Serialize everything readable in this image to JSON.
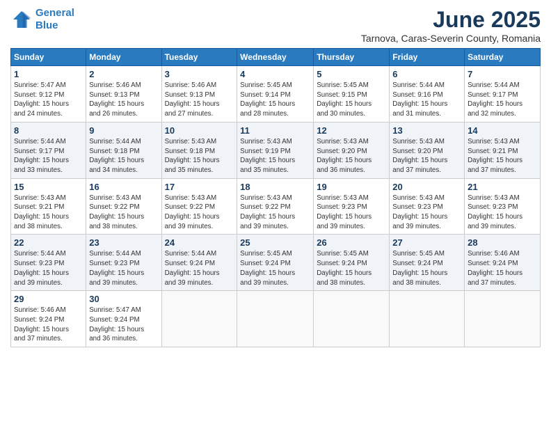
{
  "logo": {
    "line1": "General",
    "line2": "Blue"
  },
  "title": "June 2025",
  "location": "Tarnova, Caras-Severin County, Romania",
  "weekdays": [
    "Sunday",
    "Monday",
    "Tuesday",
    "Wednesday",
    "Thursday",
    "Friday",
    "Saturday"
  ],
  "weeks": [
    [
      {
        "day": "1",
        "info": "Sunrise: 5:47 AM\nSunset: 9:12 PM\nDaylight: 15 hours\nand 24 minutes."
      },
      {
        "day": "2",
        "info": "Sunrise: 5:46 AM\nSunset: 9:13 PM\nDaylight: 15 hours\nand 26 minutes."
      },
      {
        "day": "3",
        "info": "Sunrise: 5:46 AM\nSunset: 9:13 PM\nDaylight: 15 hours\nand 27 minutes."
      },
      {
        "day": "4",
        "info": "Sunrise: 5:45 AM\nSunset: 9:14 PM\nDaylight: 15 hours\nand 28 minutes."
      },
      {
        "day": "5",
        "info": "Sunrise: 5:45 AM\nSunset: 9:15 PM\nDaylight: 15 hours\nand 30 minutes."
      },
      {
        "day": "6",
        "info": "Sunrise: 5:44 AM\nSunset: 9:16 PM\nDaylight: 15 hours\nand 31 minutes."
      },
      {
        "day": "7",
        "info": "Sunrise: 5:44 AM\nSunset: 9:17 PM\nDaylight: 15 hours\nand 32 minutes."
      }
    ],
    [
      {
        "day": "8",
        "info": "Sunrise: 5:44 AM\nSunset: 9:17 PM\nDaylight: 15 hours\nand 33 minutes."
      },
      {
        "day": "9",
        "info": "Sunrise: 5:44 AM\nSunset: 9:18 PM\nDaylight: 15 hours\nand 34 minutes."
      },
      {
        "day": "10",
        "info": "Sunrise: 5:43 AM\nSunset: 9:18 PM\nDaylight: 15 hours\nand 35 minutes."
      },
      {
        "day": "11",
        "info": "Sunrise: 5:43 AM\nSunset: 9:19 PM\nDaylight: 15 hours\nand 35 minutes."
      },
      {
        "day": "12",
        "info": "Sunrise: 5:43 AM\nSunset: 9:20 PM\nDaylight: 15 hours\nand 36 minutes."
      },
      {
        "day": "13",
        "info": "Sunrise: 5:43 AM\nSunset: 9:20 PM\nDaylight: 15 hours\nand 37 minutes."
      },
      {
        "day": "14",
        "info": "Sunrise: 5:43 AM\nSunset: 9:21 PM\nDaylight: 15 hours\nand 37 minutes."
      }
    ],
    [
      {
        "day": "15",
        "info": "Sunrise: 5:43 AM\nSunset: 9:21 PM\nDaylight: 15 hours\nand 38 minutes."
      },
      {
        "day": "16",
        "info": "Sunrise: 5:43 AM\nSunset: 9:22 PM\nDaylight: 15 hours\nand 38 minutes."
      },
      {
        "day": "17",
        "info": "Sunrise: 5:43 AM\nSunset: 9:22 PM\nDaylight: 15 hours\nand 39 minutes."
      },
      {
        "day": "18",
        "info": "Sunrise: 5:43 AM\nSunset: 9:22 PM\nDaylight: 15 hours\nand 39 minutes."
      },
      {
        "day": "19",
        "info": "Sunrise: 5:43 AM\nSunset: 9:23 PM\nDaylight: 15 hours\nand 39 minutes."
      },
      {
        "day": "20",
        "info": "Sunrise: 5:43 AM\nSunset: 9:23 PM\nDaylight: 15 hours\nand 39 minutes."
      },
      {
        "day": "21",
        "info": "Sunrise: 5:43 AM\nSunset: 9:23 PM\nDaylight: 15 hours\nand 39 minutes."
      }
    ],
    [
      {
        "day": "22",
        "info": "Sunrise: 5:44 AM\nSunset: 9:23 PM\nDaylight: 15 hours\nand 39 minutes."
      },
      {
        "day": "23",
        "info": "Sunrise: 5:44 AM\nSunset: 9:23 PM\nDaylight: 15 hours\nand 39 minutes."
      },
      {
        "day": "24",
        "info": "Sunrise: 5:44 AM\nSunset: 9:24 PM\nDaylight: 15 hours\nand 39 minutes."
      },
      {
        "day": "25",
        "info": "Sunrise: 5:45 AM\nSunset: 9:24 PM\nDaylight: 15 hours\nand 39 minutes."
      },
      {
        "day": "26",
        "info": "Sunrise: 5:45 AM\nSunset: 9:24 PM\nDaylight: 15 hours\nand 38 minutes."
      },
      {
        "day": "27",
        "info": "Sunrise: 5:45 AM\nSunset: 9:24 PM\nDaylight: 15 hours\nand 38 minutes."
      },
      {
        "day": "28",
        "info": "Sunrise: 5:46 AM\nSunset: 9:24 PM\nDaylight: 15 hours\nand 37 minutes."
      }
    ],
    [
      {
        "day": "29",
        "info": "Sunrise: 5:46 AM\nSunset: 9:24 PM\nDaylight: 15 hours\nand 37 minutes."
      },
      {
        "day": "30",
        "info": "Sunrise: 5:47 AM\nSunset: 9:24 PM\nDaylight: 15 hours\nand 36 minutes."
      },
      {
        "day": "",
        "info": ""
      },
      {
        "day": "",
        "info": ""
      },
      {
        "day": "",
        "info": ""
      },
      {
        "day": "",
        "info": ""
      },
      {
        "day": "",
        "info": ""
      }
    ]
  ]
}
